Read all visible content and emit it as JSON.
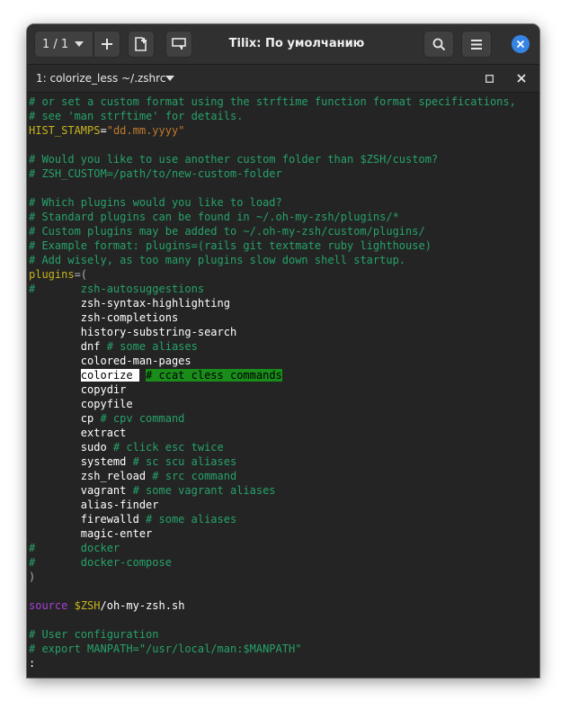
{
  "header": {
    "session_label": "1 / 1",
    "title": "Tilix: По умолчанию"
  },
  "tab": {
    "title": "1: colorize_less ~/.zshrc"
  },
  "colors": {
    "accent": "#3584e4",
    "comment": "#26a269",
    "identifier": "#c8b41c",
    "string": "#c07a2c",
    "keyword": "#a541d6",
    "match_highlight": "#1a8c1a"
  },
  "terminal": {
    "lines": [
      [
        {
          "t": "# or set a custom format using the strftime function format specifications,",
          "c": "comment"
        }
      ],
      [
        {
          "t": "# see 'man strftime' for details.",
          "c": "comment"
        }
      ],
      [
        {
          "t": "HIST_STAMPS",
          "c": "ident"
        },
        {
          "t": "=",
          "c": "white"
        },
        {
          "t": "\"dd.mm.yyyy\"",
          "c": "string"
        }
      ],
      [],
      [
        {
          "t": "# Would you like to use another custom folder than $ZSH/custom?",
          "c": "comment"
        }
      ],
      [
        {
          "t": "# ZSH_CUSTOM=/path/to/new-custom-folder",
          "c": "comment"
        }
      ],
      [],
      [
        {
          "t": "# Which plugins would you like to load?",
          "c": "comment"
        }
      ],
      [
        {
          "t": "# Standard plugins can be found in ~/.oh-my-zsh/plugins/*",
          "c": "comment"
        }
      ],
      [
        {
          "t": "# Custom plugins may be added to ~/.oh-my-zsh/custom/plugins/",
          "c": "comment"
        }
      ],
      [
        {
          "t": "# Example format: plugins=(rails git textmate ruby lighthouse)",
          "c": "comment"
        }
      ],
      [
        {
          "t": "# Add wisely, as too many plugins slow down shell startup.",
          "c": "comment"
        }
      ],
      [
        {
          "t": "plugins",
          "c": "ident"
        },
        {
          "t": "=(",
          "c": "paren"
        }
      ],
      [
        {
          "t": "#       zsh-autosuggestions",
          "c": "comment"
        }
      ],
      [
        {
          "t": "        zsh-syntax-highlighting",
          "c": "white"
        }
      ],
      [
        {
          "t": "        zsh-completions",
          "c": "white"
        }
      ],
      [
        {
          "t": "        history-substring-search",
          "c": "white"
        }
      ],
      [
        {
          "t": "        dnf ",
          "c": "white"
        },
        {
          "t": "# some aliases",
          "c": "comment"
        }
      ],
      [
        {
          "t": "        colored-man-pages",
          "c": "white"
        }
      ],
      [
        {
          "t": "        ",
          "c": "white"
        },
        {
          "t": "colorize ",
          "c": "cursor"
        },
        {
          "t": " ",
          "c": "white"
        },
        {
          "t": "# ccat cless commands",
          "c": "match"
        }
      ],
      [
        {
          "t": "        copydir",
          "c": "white"
        }
      ],
      [
        {
          "t": "        copyfile",
          "c": "white"
        }
      ],
      [
        {
          "t": "        cp ",
          "c": "white"
        },
        {
          "t": "# cpv command",
          "c": "comment"
        }
      ],
      [
        {
          "t": "        extract",
          "c": "white"
        }
      ],
      [
        {
          "t": "        sudo ",
          "c": "white"
        },
        {
          "t": "# click esc twice",
          "c": "comment"
        }
      ],
      [
        {
          "t": "        systemd ",
          "c": "white"
        },
        {
          "t": "# sc scu aliases",
          "c": "comment"
        }
      ],
      [
        {
          "t": "        zsh_reload ",
          "c": "white"
        },
        {
          "t": "# src command",
          "c": "comment"
        }
      ],
      [
        {
          "t": "        vagrant ",
          "c": "white"
        },
        {
          "t": "# some vagrant aliases",
          "c": "comment"
        }
      ],
      [
        {
          "t": "        alias-finder",
          "c": "white"
        }
      ],
      [
        {
          "t": "        firewalld ",
          "c": "white"
        },
        {
          "t": "# some aliases",
          "c": "comment"
        }
      ],
      [
        {
          "t": "        magic-enter",
          "c": "white"
        }
      ],
      [
        {
          "t": "#       docker",
          "c": "comment"
        }
      ],
      [
        {
          "t": "#       docker-compose",
          "c": "comment"
        }
      ],
      [
        {
          "t": ")",
          "c": "paren"
        }
      ],
      [],
      [
        {
          "t": "source",
          "c": "keyword"
        },
        {
          "t": " ",
          "c": "white"
        },
        {
          "t": "$ZSH",
          "c": "var"
        },
        {
          "t": "/oh-my-zsh.sh",
          "c": "white"
        }
      ],
      [],
      [
        {
          "t": "# User configuration",
          "c": "comment"
        }
      ],
      [
        {
          "t": "# export MANPATH=\"/usr/local/man:$MANPATH\"",
          "c": "comment"
        }
      ],
      [
        {
          "t": ":",
          "c": "white"
        }
      ]
    ]
  }
}
